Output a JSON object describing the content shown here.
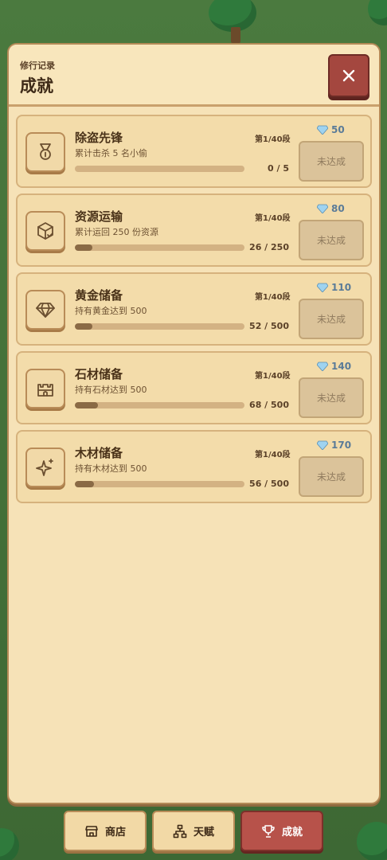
{
  "header": {
    "subtitle": "修行记录",
    "title": "成就"
  },
  "achievements": [
    {
      "name": "除盗先锋",
      "desc": "累计击杀 5 名小偷",
      "stage": "第1/40段",
      "progress_text": "0 / 5",
      "progress": 0.0,
      "reward": "50",
      "status": "未达成",
      "icon": "medal-icon"
    },
    {
      "name": "资源运输",
      "desc": "累计运回 250 份资源",
      "stage": "第1/40段",
      "progress_text": "26 / 250",
      "progress": 0.104,
      "reward": "80",
      "status": "未达成",
      "icon": "package-icon"
    },
    {
      "name": "黄金储备",
      "desc": "持有黄金达到 500",
      "stage": "第1/40段",
      "progress_text": "52 / 500",
      "progress": 0.104,
      "reward": "110",
      "status": "未达成",
      "icon": "gem-icon"
    },
    {
      "name": "石材储备",
      "desc": "持有石材达到 500",
      "stage": "第1/40段",
      "progress_text": "68 / 500",
      "progress": 0.136,
      "reward": "140",
      "status": "未达成",
      "icon": "castle-icon"
    },
    {
      "name": "木材储备",
      "desc": "持有木材达到 500",
      "stage": "第1/40段",
      "progress_text": "56 / 500",
      "progress": 0.112,
      "reward": "170",
      "status": "未达成",
      "icon": "sparkle-icon"
    }
  ],
  "nav": {
    "shop": "商店",
    "talent": "天赋",
    "achievements": "成就"
  },
  "colors": {
    "accent": "#b7524a",
    "panel": "#f6e2b7",
    "reward": "#5a7b98"
  }
}
